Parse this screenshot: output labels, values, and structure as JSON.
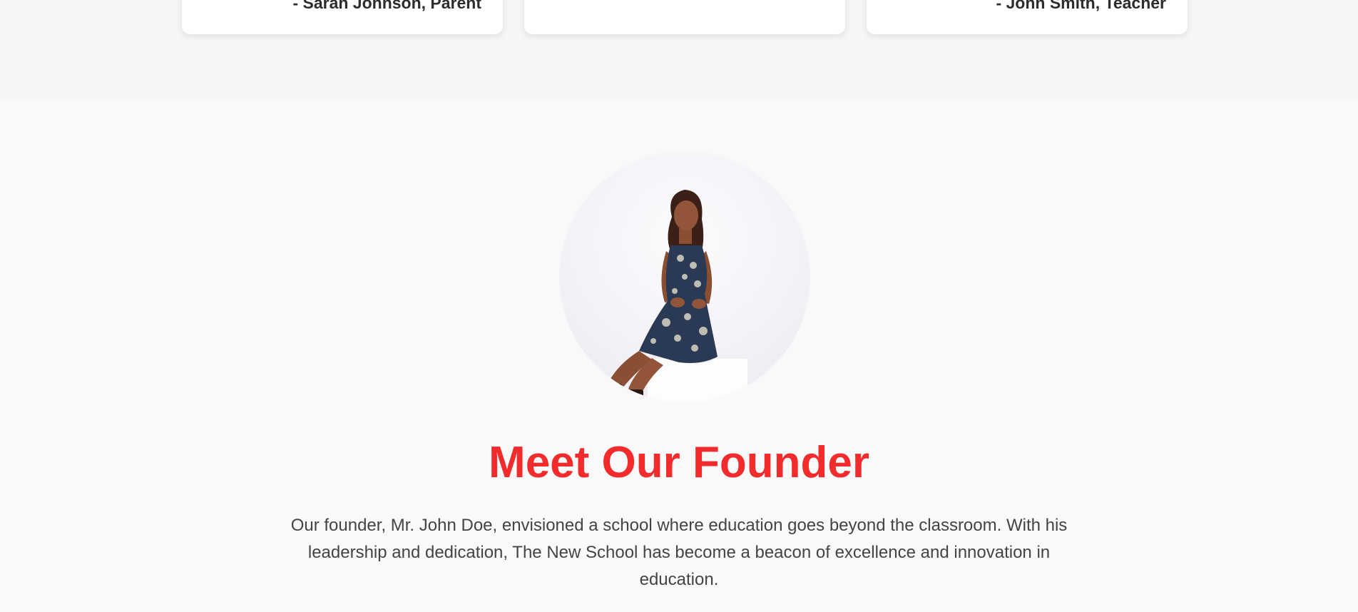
{
  "testimonials": {
    "cards": [
      {
        "author": "- Sarah Johnson, Parent"
      },
      {
        "author": ""
      },
      {
        "author": "- John Smith, Teacher"
      }
    ]
  },
  "founder": {
    "title": "Meet Our Founder",
    "description": "Our founder, Mr. John Doe, envisioned a school where education goes beyond the classroom. With his leadership and dedication, The New School has become a beacon of excellence and innovation in education.",
    "photo_icon": "founder-portrait",
    "accent_color": "#f22c2c"
  }
}
